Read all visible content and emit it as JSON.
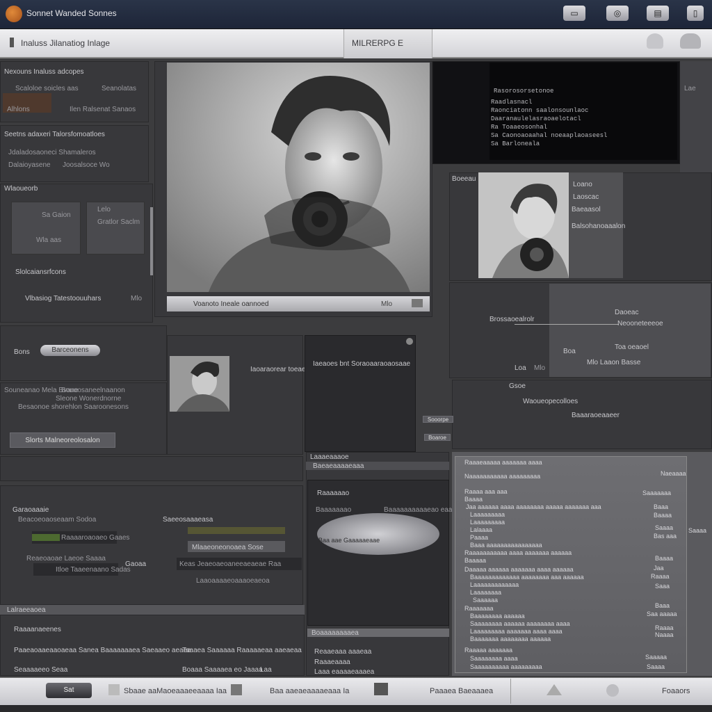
{
  "app": {
    "title": "Sonnet Wanded Sonnes"
  },
  "topbar": {
    "icons": [
      "monitor-icon",
      "headphones-icon",
      "device-icon",
      "mobile-icon"
    ]
  },
  "toolbar": {
    "breadcrumb": "Inaluss Jilanatiog Inlage",
    "tab_label": "MILRERPG E"
  },
  "left_panel": {
    "section1_title": "Nexouns Inaluss adcopes",
    "section1_items": [
      "Scaloloe soicles aas",
      "Seanolatas",
      "Alhlons",
      "Ilen Ralsenat Sanaos"
    ],
    "section2_title": "Seetns adaxeri Talorsfomoatloes",
    "section2_items": [
      "Jdaladosaoneci Shamaleros",
      "Dalaioyasene",
      "Joosalsoce Wo"
    ],
    "section3_title": "Wlaoueorb",
    "section3_items": [
      "Sa Gaion",
      "Lelo",
      "Gratlor Saclm",
      "Wla aas"
    ],
    "section3_sub": "Slolcaiansrfcons",
    "section3_status": "Vlbasiog Tatestoouuhars",
    "section4_label": "Bons",
    "slider_label": "Barceonens",
    "section5_items": [
      "Souneanao Mela Bvane",
      "Bouoosaneelnaanon",
      "Besaonoe shorehlon Saaroonesons",
      "Sleone Wonerdnorne"
    ],
    "section5_button": "Slorts Malneoreolosalon"
  },
  "main_photo": {
    "caption": "Voanoto Ineale oannoed",
    "badge": "Mlo"
  },
  "code_panel": {
    "lines": [
      "Rasorosorsetonoe",
      "Raadlasnacl",
      "Raonciatonn saalonsounlaoc",
      "Daaranaulelasraoaelotacl",
      "Ra Toaaeosonhal",
      "Sa Caonoaoaahal noeaaplaoaseesl",
      "Sa Barloneala"
    ],
    "side_text": "Lae"
  },
  "right_photo_panel": {
    "title": "Boeeau",
    "items": [
      "Loano",
      "Laoscac",
      "Baeaasol",
      "Balsohanoaaalon"
    ]
  },
  "right_mid_panel": {
    "label_a": "Brossaoealrolr",
    "label_b": "Daoeac",
    "label_c": "Neooneteeeoe",
    "label_d": "Toa oeaoel",
    "label_e": "Loa",
    "label_f": "Boa",
    "label_g": "Mlo Laaon Basse"
  },
  "right_lower_panel": {
    "label_a": "Gsoe",
    "label_b": "Waoueopecolloes",
    "label_c": "Baaaraoeaaeer"
  },
  "center_panel": {
    "label": "Iaoaraorear toeae",
    "desc": "Iaeaoes bnt Soraoaaraoaosaae",
    "side_buttons": [
      "Sooorpe",
      "Boaroe"
    ]
  },
  "bottom_left": {
    "title": "Garaoaaaie",
    "row1_left": "Beacoeoaoseaam Sodoa",
    "row1_right": "Saeeosaaaeasa",
    "field1": "Raaaaroaoaeo Gaaes",
    "field2": "Mlaaeoneonoaea Sose",
    "label3": "Reaeoaoae Laeoe Saaaa",
    "field3": "Itloe Taaeenaano Sadas",
    "label4": "Gaoaa",
    "field4": "Keas Jeaeoaeoaneeaeaeae Raa",
    "field5": "Laaoaaaaeoaaaoeaeoa"
  },
  "bottom_left_footer": {
    "bar_label": "Lalraeeaoea",
    "title": "Raaaanaeenes",
    "row1": "Paaeaoaaeaaoaeaa Sanea Baaaaaaaea Saeaaeo aeaea",
    "row1b": "Taaaea Saaaaaa Raaaaaeaa aaeaeaa",
    "row2": "Seaaaaeeo Seaa",
    "row2b": "Boaaa Saaaaea eo Jaaaa",
    "row2c": "Laa"
  },
  "center_lower": {
    "header_a": "Laaaeaaaoe",
    "header_b": "Baeaeaaaaeaaa",
    "row_a": "Raaaaaao",
    "row_b": "Baaaaaaao",
    "row_b2": "Baaaaaaaaaaeao eaaaa",
    "blob_label": "Baa aae Gaaaaaeaae",
    "footer_title": "Boaaaaaaaaea",
    "footer_items": [
      "Reaaeaaa aaaeaa",
      "Raaaeaaaa",
      "Laaa eaaaaeaaaea"
    ]
  },
  "list_panel": {
    "header": "Raaaeaaaaa aaaaaaa aaaa",
    "header2": "Naaaaaaaaaaa aaaaaaaaa",
    "top_right": "Naeaaaa",
    "lines": [
      "Raaaa aaa aaa",
      "Baaaa",
      "Jaa aaaaaa aaaa aaaaaaaa aaaaa aaaaaaa aaa",
      "Laaaaaaaaa",
      "Laaaaaaaaa",
      "Lalaaaa",
      "Paaaa",
      "Baaa aaaaaaaaaaaaaaaa",
      "Raaaaaaaaaaa aaaa aaaaaaa aaaaaa",
      "Baaaaa",
      "Daaaaa aaaaaa aaaaaaa aaaa aaaaaa",
      "Baaaaaaaaaaaaa aaaaaaaa aaa aaaaaa",
      "Laaaaaaaaaaaaa",
      "Laaaaaaaa",
      "Saaaaaa",
      "Raaaaaaa",
      "Baaaaaaaa aaaaaa",
      "Saaaaaaaa aaaaaa aaaaaaaa aaaa",
      "Laaaaaaaaa aaaaaaa aaaa aaaa",
      "Baaaaaaa aaaaaaaa aaaaaa",
      "Raaaaa aaaaaaa",
      "Saaaaaaaa aaaa",
      "Saaaaaaaaaa aaaaaaaaa"
    ],
    "right_values": [
      "Saaaaaaa",
      "Baaa",
      "Baaaa",
      "Saaaa",
      "Bas aaa",
      "Baaaa",
      "Jaa",
      "Raaaa",
      "Saaa",
      "Baaa",
      "Saa aaaaa",
      "Raaaa",
      "Naaaa",
      "Saaaaa",
      "Saaaa"
    ],
    "side_right": "Saaaa"
  },
  "bottombar": {
    "left_button": "Sat",
    "items": [
      "Sbaae aaMaoeaaaeeaaaa Iaa",
      "Baa aaeaeaaaaeaaa Ia",
      "Paaaea Baeaaaea"
    ],
    "right": "Foaaors"
  }
}
